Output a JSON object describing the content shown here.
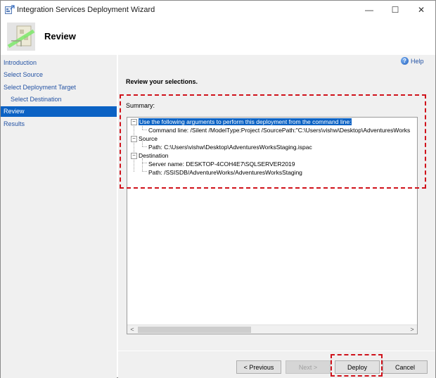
{
  "window": {
    "title": "Integration Services Deployment Wizard",
    "controls": {
      "minimize": "—",
      "maximize": "☐",
      "close": "✕"
    }
  },
  "header": {
    "title": "Review",
    "icon": "deployment-wizard-icon"
  },
  "sidebar": {
    "items": [
      {
        "label": "Introduction",
        "level": 0,
        "active": false
      },
      {
        "label": "Select Source",
        "level": 0,
        "active": false
      },
      {
        "label": "Select Deployment Target",
        "level": 0,
        "active": false
      },
      {
        "label": "Select Destination",
        "level": 1,
        "active": false
      },
      {
        "label": "Review",
        "level": 0,
        "active": true
      },
      {
        "label": "Results",
        "level": 0,
        "active": false
      }
    ]
  },
  "content": {
    "help_label": "Help",
    "section_title": "Review your selections.",
    "summary_label": "Summary:",
    "tree": [
      {
        "label": "Use the following arguments to perform this deployment from the command line:",
        "level": 0,
        "expanded": true,
        "selected": true
      },
      {
        "label": "Command line: /Silent /ModelType:Project /SourcePath:\"C:\\Users\\vishw\\Desktop\\AdventuresWorks",
        "level": 1
      },
      {
        "label": "Source",
        "level": 0,
        "expanded": true
      },
      {
        "label": "Path: C:\\Users\\vishw\\Desktop\\AdventuresWorksStaging.ispac",
        "level": 1
      },
      {
        "label": "Destination",
        "level": 0,
        "expanded": true
      },
      {
        "label": "Server name: DESKTOP-4COH4E7\\SQLSERVER2019",
        "level": 1
      },
      {
        "label": "Path: /SSISDB/AdventureWorks/AdventuresWorksStaging",
        "level": 1
      }
    ],
    "scroll_left": "<",
    "scroll_right": ">"
  },
  "footer": {
    "previous": "< Previous",
    "next": "Next >",
    "deploy": "Deploy",
    "cancel": "Cancel"
  },
  "colors": {
    "accent": "#0b62c4",
    "link": "#2453a4",
    "annotation": "#d0121b"
  }
}
